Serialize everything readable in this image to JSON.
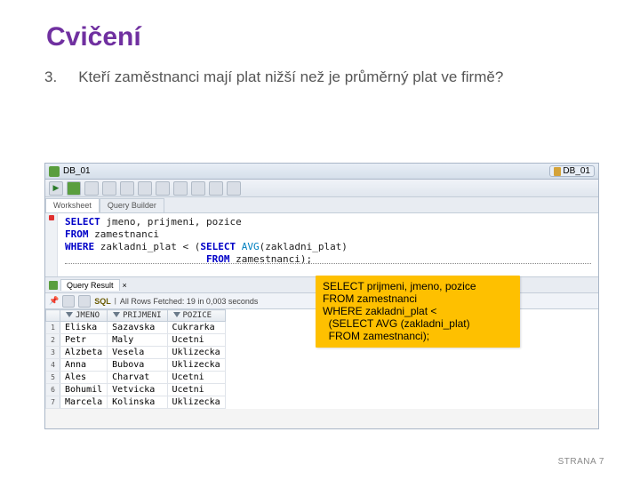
{
  "slide": {
    "title": "Cvičení",
    "question_number": "3.",
    "question_text": "Kteří zaměstnanci mají plat nižší než je průměrný plat ve firmě?"
  },
  "app": {
    "connection_label": "DB_01",
    "top_badge": "DB_01",
    "tabs": {
      "worksheet": "Worksheet",
      "querybuilder": "Query Builder"
    },
    "sql_lines": [
      {
        "pre": "",
        "kw": "SELECT",
        "rest": " jmeno, prijmeni, pozice"
      },
      {
        "pre": "",
        "kw": "FROM",
        "rest": " zamestnanci"
      },
      {
        "pre": "",
        "kw": "WHERE",
        "rest": " zakladni_plat < (",
        "kw2": "SELECT",
        "fn": " AVG",
        "rest2": "(zakladni_plat)"
      },
      {
        "pre": "                        ",
        "kw": "FROM",
        "rest": " zamestnanci);"
      }
    ],
    "result_tab": "Query Result",
    "sql_icon_label": "SQL",
    "fetch_status": "All Rows Fetched: 19 in 0,003 seconds",
    "columns": [
      "JMENO",
      "PRIJMENI",
      "POZICE"
    ],
    "rows": [
      [
        "1",
        "Eliska",
        "Sazavska",
        "Cukrarka"
      ],
      [
        "2",
        "Petr",
        "Maly",
        "Ucetni"
      ],
      [
        "3",
        "Alzbeta",
        "Vesela",
        "Uklizecka"
      ],
      [
        "4",
        "Anna",
        "Bubova",
        "Uklizecka"
      ],
      [
        "5",
        "Ales",
        "Charvat",
        "Ucetni"
      ],
      [
        "6",
        "Bohumil",
        "Vetvicka",
        "Ucetni"
      ],
      [
        "7",
        "Marcela",
        "Kolinska",
        "Uklizecka"
      ]
    ]
  },
  "callout": {
    "l1": "SELECT prijmeni, jmeno, pozice",
    "l2": "FROM zamestnanci",
    "l3": "WHERE zakladni_plat <",
    "l4": "  (SELECT AVG (zakladni_plat)",
    "l5": "  FROM zamestnanci);"
  },
  "footer": {
    "page_label": "STRANA 7"
  }
}
